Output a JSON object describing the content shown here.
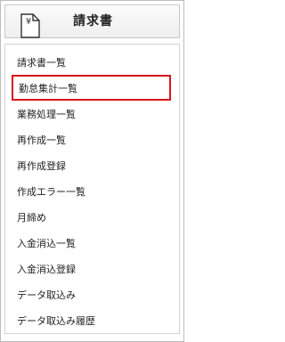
{
  "header": {
    "title": "請求書",
    "icon": "document-yen-icon",
    "icon_glyph": "¥"
  },
  "menu": {
    "selected_index": 1,
    "highlight_color": "#d9141c",
    "items": [
      {
        "label": "請求書一覧"
      },
      {
        "label": "勤怠集計一覧"
      },
      {
        "label": "業務処理一覧"
      },
      {
        "label": "再作成一覧"
      },
      {
        "label": "再作成登録"
      },
      {
        "label": "作成エラー一覧"
      },
      {
        "label": "月締め"
      },
      {
        "label": "入金消込一覧"
      },
      {
        "label": "入金消込登録"
      },
      {
        "label": "データ取込み"
      },
      {
        "label": "データ取込み履歴"
      }
    ]
  }
}
